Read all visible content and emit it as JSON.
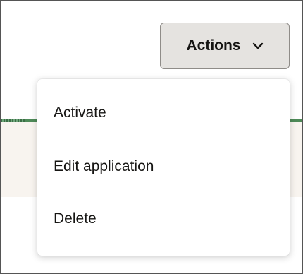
{
  "toolbar": {
    "actions_label": "Actions",
    "actions_icon": "chevron-down-icon"
  },
  "menu": {
    "items": [
      {
        "label": "Activate"
      },
      {
        "label": "Edit application"
      },
      {
        "label": "Delete"
      }
    ]
  },
  "colors": {
    "button_bg": "#e5e3e0",
    "button_border": "#8f8c88",
    "text": "#161513",
    "green_accent": "#4e8a58",
    "band_bg": "#f8f4ef"
  }
}
